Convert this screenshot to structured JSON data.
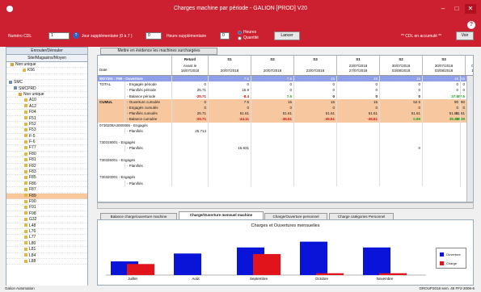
{
  "window": {
    "title": "Charges machine par période - GALION [PROD] V20",
    "minimize": "–",
    "maximize": "□",
    "close": "✕"
  },
  "toolbar": {
    "cdl_label": "Numéro CDL",
    "cdl_value": "1",
    "jour_label": "Jour supplémentaire (0 à 7 )",
    "jour_value": "0",
    "heure_label": "Heure supplémentaire",
    "heure_value": "0",
    "radio_heures": "Heures",
    "radio_quantite": "Quantité",
    "lancer": "Lancer",
    "cdl_notice": "** CDL en accumulé **",
    "voir": "Voir"
  },
  "tree": {
    "toggle_label": "Enrouler/Dérouler",
    "header": "Site/Magasins/Moyen",
    "rows": [
      {
        "label": "Non unique",
        "indent": 5,
        "icon": "folder"
      },
      {
        "label": "K56",
        "indent": 20,
        "icon": "shelf"
      },
      {
        "label": "",
        "indent": 0,
        "icon": ""
      },
      {
        "label": "SMC",
        "indent": 3,
        "icon": "pc"
      },
      {
        "label": "SMCPRD",
        "indent": 9,
        "icon": "pc"
      },
      {
        "label": "Non unique",
        "indent": 15,
        "icon": "folder"
      },
      {
        "label": "A10",
        "indent": 22,
        "icon": "shelf"
      },
      {
        "label": "A12",
        "indent": 22,
        "icon": "shelf"
      },
      {
        "label": "F04",
        "indent": 22,
        "icon": "shelf"
      },
      {
        "label": "F51",
        "indent": 22,
        "icon": "shelf"
      },
      {
        "label": "F52",
        "indent": 22,
        "icon": "shelf"
      },
      {
        "label": "F53",
        "indent": 22,
        "icon": "shelf"
      },
      {
        "label": "F-5",
        "indent": 22,
        "icon": "shelf"
      },
      {
        "label": "F-6",
        "indent": 22,
        "icon": "shelf"
      },
      {
        "label": "F77",
        "indent": 22,
        "icon": "shelf"
      },
      {
        "label": "F80",
        "indent": 22,
        "icon": "shelf"
      },
      {
        "label": "F81",
        "indent": 22,
        "icon": "shelf"
      },
      {
        "label": "F82",
        "indent": 22,
        "icon": "shelf"
      },
      {
        "label": "F83",
        "indent": 22,
        "icon": "shelf"
      },
      {
        "label": "F85",
        "indent": 22,
        "icon": "shelf"
      },
      {
        "label": "F86",
        "indent": 22,
        "icon": "shelf"
      },
      {
        "label": "F87",
        "indent": 22,
        "icon": "shelf"
      },
      {
        "label": "F89",
        "indent": 22,
        "icon": "shelf",
        "selected": true
      },
      {
        "label": "F90",
        "indent": 22,
        "icon": "shelf"
      },
      {
        "label": "F91",
        "indent": 22,
        "icon": "shelf"
      },
      {
        "label": "F98",
        "indent": 22,
        "icon": "shelf"
      },
      {
        "label": "G32",
        "indent": 22,
        "icon": "shelf"
      },
      {
        "label": "L48",
        "indent": 22,
        "icon": "shelf"
      },
      {
        "label": "L76",
        "indent": 22,
        "icon": "shelf"
      },
      {
        "label": "L77",
        "indent": 22,
        "icon": "shelf"
      },
      {
        "label": "L80",
        "indent": 22,
        "icon": "shelf"
      },
      {
        "label": "L81",
        "indent": 22,
        "icon": "shelf"
      },
      {
        "label": "L84",
        "indent": 22,
        "icon": "shelf"
      },
      {
        "label": "L88",
        "indent": 22,
        "icon": "shelf"
      }
    ]
  },
  "highlight_button": "Mettre en évidence les machines surchargées",
  "grid": {
    "columns": [
      {
        "top": "Date",
        "d1": "",
        "d2": ""
      },
      {
        "top": "Retard",
        "d1": "Avant le",
        "d2": "16/07/2018"
      },
      {
        "top": "S1",
        "d1": "",
        "d2": "20/07/2018"
      },
      {
        "top": "S2",
        "d1": "",
        "d2": "20/07/2018"
      },
      {
        "top": "S3",
        "d1": "",
        "d2": "23/07/2018"
      },
      {
        "top": "S1",
        "d1": "23/07/2018",
        "d2": "27/07/2018"
      },
      {
        "top": "S2",
        "d1": "30/07/2018",
        "d2": "03/08/2018"
      },
      {
        "top": "S3",
        "d1": "30/07/2018",
        "d2": "03/08/2018"
      },
      {
        "top": "S4",
        "d1": "06/08/2018",
        "d2": "10/08/2018"
      }
    ],
    "rows": [
      {
        "style": "blue",
        "c0": "MOYEN : F89 - Ouverture",
        "c1": "",
        "cells": [
          "",
          "7.5",
          "7.5",
          "15",
          "15",
          "15",
          "15",
          "15"
        ]
      },
      {
        "style": "",
        "c0": "TOTAL",
        "c1": "- Engagés période",
        "cells": [
          "0",
          "0",
          "0",
          "0",
          "0",
          "0",
          "0",
          "0"
        ]
      },
      {
        "style": "",
        "c0": "",
        "c1": "- Planifiés période",
        "cells": [
          "25.71",
          "15.9",
          "0",
          "0",
          "0",
          "0",
          "0",
          "0"
        ]
      },
      {
        "style": "",
        "c0": "",
        "c1": "- Balance période",
        "cells": [
          "-25.71",
          "-8.4",
          "7.5",
          "0",
          "0",
          "0",
          "37.5",
          "37.5"
        ]
      },
      {
        "style": "orange",
        "c0": "CUMUL",
        "c1": "- Ouverture cumulée",
        "cells": [
          "0",
          "7.5",
          "15",
          "15",
          "15",
          "52.5",
          "90",
          "90"
        ]
      },
      {
        "style": "orange",
        "c0": "",
        "c1": "- Engagés cumulés",
        "cells": [
          "0",
          "0",
          "0",
          "0",
          "0",
          "0",
          "0",
          "0"
        ]
      },
      {
        "style": "orange",
        "c0": "",
        "c1": "- Planifiés cumulés",
        "cells": [
          "25.71",
          "51.61",
          "51.61",
          "51.61",
          "51.61",
          "51.61",
          "51.61",
          "51.61"
        ]
      },
      {
        "style": "orange",
        "c0": "",
        "c1": "- Balance cumulée",
        "cells": [
          "-25.71",
          "-44.11",
          "-36.61",
          "-36.61",
          "-36.61",
          "0.89",
          "38.39",
          "38.39"
        ]
      },
      {
        "style": "",
        "c0": "0730208A3000066 - Engagés",
        "c1": "",
        "cells": [
          "",
          "",
          "",
          "",
          "",
          "",
          "",
          ""
        ]
      },
      {
        "style": "",
        "c0": "",
        "c1": "- Planifiés",
        "cells": [
          "25.714",
          "",
          "",
          "",
          "",
          "",
          "",
          ""
        ]
      },
      {
        "style": "",
        "c0": "",
        "c1": "",
        "cells": [
          "",
          "",
          "",
          "",
          "",
          "",
          "",
          ""
        ]
      },
      {
        "style": "",
        "c0": "730319001 - Engagés",
        "c1": "",
        "cells": [
          "",
          "",
          "",
          "",
          "",
          "",
          "",
          ""
        ]
      },
      {
        "style": "",
        "c0": "",
        "c1": "- Planifiés",
        "cells": [
          "",
          "15.931",
          "",
          "",
          "",
          "0",
          "",
          ""
        ]
      },
      {
        "style": "",
        "c0": "",
        "c1": "",
        "cells": [
          "",
          "",
          "",
          "",
          "",
          "",
          "",
          ""
        ]
      },
      {
        "style": "",
        "c0": "730326001 - Engagés",
        "c1": "",
        "cells": [
          "",
          "",
          "",
          "",
          "",
          "",
          "",
          ""
        ]
      },
      {
        "style": "",
        "c0": "",
        "c1": "- Planifiés",
        "cells": [
          "",
          "",
          "",
          "",
          "",
          "",
          "",
          ""
        ]
      },
      {
        "style": "",
        "c0": "",
        "c1": "",
        "cells": [
          "",
          "",
          "",
          "",
          "",
          "",
          "",
          ""
        ]
      },
      {
        "style": "",
        "c0": "730320001 - Engagés",
        "c1": "",
        "cells": [
          "",
          "",
          "",
          "",
          "",
          "",
          "",
          ""
        ]
      },
      {
        "style": "",
        "c0": "",
        "c1": "- Planifiés",
        "cells": [
          "",
          "",
          "",
          "",
          "",
          "",
          "",
          ""
        ]
      }
    ]
  },
  "tabs": [
    "Balance charge/ouverture machine",
    "Charge/Ouverture mensuel machine",
    "Charge/Ouverture personnel",
    "Charge catégories Personnel"
  ],
  "colors": {
    "ouverture": "#0a14d8",
    "charge": "#e0141a",
    "header_red": "#cc2030",
    "blue_row": "#8f9fe8",
    "orange_row": "#f7c8a0"
  },
  "chart_data": {
    "type": "bar",
    "title": "Charges et Ouvertures mensuelles",
    "categories": [
      "Juillet",
      "Août",
      "Septembre",
      "Octobre",
      "Novembre"
    ],
    "series": [
      {
        "name": "Ouverture",
        "values": [
          52,
          82,
          105,
          127,
          105
        ]
      },
      {
        "name": "Charge",
        "values": [
          42,
          0,
          80,
          7,
          7
        ]
      }
    ],
    "ylim": [
      0,
      135
    ],
    "grid": false,
    "legend": "right"
  },
  "status": {
    "left": "Galion Automation",
    "right": "GROUP2018 sem. 45 FF2-2006-6"
  }
}
